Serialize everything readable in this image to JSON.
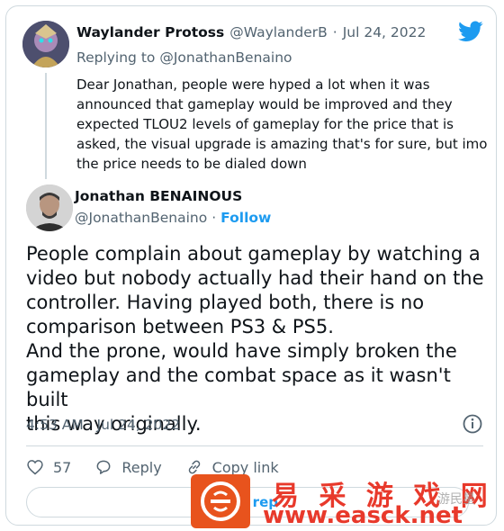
{
  "parent_tweet": {
    "author_name": "Waylander Protoss",
    "handle": "@WaylanderB",
    "separator": "·",
    "date": "Jul 24, 2022",
    "replying_prefix": "Replying to",
    "replying_to": "@JonathanBenaino",
    "text": "Dear Jonathan, people were hyped a lot when it was announced that gameplay would be improved and they expected TLOU2 levels of gameplay for the price that is asked, the visual upgrade is amazing that's for sure, but imo the price needs to be dialed down"
  },
  "main_tweet": {
    "author_name": "Jonathan BENAINOUS",
    "handle": "@JonathanBenaino",
    "separator": "·",
    "follow_label": "Follow",
    "text_lines": [
      "People complain about gameplay by watching a",
      "video but nobody actually had their hand on the",
      "controller. Having played both, there is no",
      "comparison between PS3 & PS5.",
      "And the prone, would have simply broken the",
      "gameplay and the combat space as it wasn't built",
      "this way originally."
    ],
    "timestamp": "4:53 AM · Jul 24, 2022"
  },
  "actions": {
    "like_count": "57",
    "reply_label": "Reply",
    "copy_link_label": "Copy link"
  },
  "replies_button": {
    "visible_label": "8 rep"
  },
  "watermark": {
    "cn_text": "易 采 游 戏 网",
    "url": "www.easck.net",
    "small_text": "游民星"
  },
  "colors": {
    "accent": "#1d9bf0",
    "secondary_text": "#536471",
    "border": "#cfd9de",
    "watermark_red": "#e8392b",
    "watermark_badge": "#e8531d"
  },
  "icons": [
    "twitter-bird-icon",
    "info-icon",
    "heart-icon",
    "reply-bubble-icon",
    "link-icon"
  ]
}
